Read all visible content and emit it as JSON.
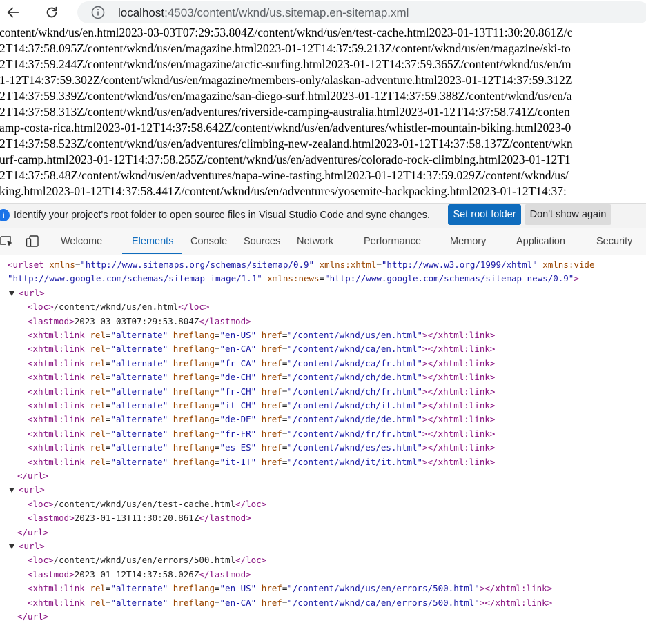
{
  "address_bar": {
    "url_host": "localhost",
    "url_rest": ":4503/content/wknd/us.sitemap.en-sitemap.xml"
  },
  "page_lines": [
    "content/wknd/us/en.html2023-03-03T07:29:53.804Z/content/wknd/us/en/test-cache.html2023-01-13T11:30:20.861Z/c",
    "2T14:37:58.095Z/content/wknd/us/en/magazine.html2023-01-12T14:37:59.213Z/content/wknd/us/en/magazine/ski-to",
    "2T14:37:59.244Z/content/wknd/us/en/magazine/arctic-surfing.html2023-01-12T14:37:59.365Z/content/wknd/us/en/m",
    "1-12T14:37:59.302Z/content/wknd/us/en/magazine/members-only/alaskan-adventure.html2023-01-12T14:37:59.312Z",
    "2T14:37:59.339Z/content/wknd/us/en/magazine/san-diego-surf.html2023-01-12T14:37:59.388Z/content/wknd/us/en/a",
    "2T14:37:58.313Z/content/wknd/us/en/adventures/riverside-camping-australia.html2023-01-12T14:37:58.741Z/conten",
    "amp-costa-rica.html2023-01-12T14:37:58.642Z/content/wknd/us/en/adventures/whistler-mountain-biking.html2023-0",
    "2T14:37:58.523Z/content/wknd/us/en/adventures/climbing-new-zealand.html2023-01-12T14:37:58.137Z/content/wkn",
    "urf-camp.html2023-01-12T14:37:58.255Z/content/wknd/us/en/adventures/colorado-rock-climbing.html2023-01-12T1",
    "2T14:37:58.48Z/content/wknd/us/en/adventures/napa-wine-tasting.html2023-01-12T14:37:59.029Z/content/wknd/us/",
    "king.html2023-01-12T14:37:58.441Z/content/wknd/us/en/adventures/yosemite-backpacking.html2023-01-12T14:37:"
  ],
  "infobar": {
    "message": "Identify your project's root folder to open source files in Visual Studio Code and sync changes.",
    "set_root_label": "Set root folder",
    "dont_show_label": "Don't show again"
  },
  "devtools_tabs": [
    "Welcome",
    "Elements",
    "Console",
    "Sources",
    "Network",
    "Performance",
    "Memory",
    "Application",
    "Security"
  ],
  "active_tab": "Elements",
  "xml": {
    "urlset_line1": {
      "open": "<urlset",
      "a1": "xmlns",
      "v1": "\"http://www.sitemaps.org/schemas/sitemap/0.9\"",
      "a2": "xmlns:xhtml",
      "v2": "\"http://www.w3.org/1999/xhtml\"",
      "a3": "xmlns:vide"
    },
    "urlset_line2": {
      "v0": "\"http://www.google.com/schemas/sitemap-image/1.1\"",
      "a": "xmlns:news",
      "v": "\"http://www.google.com/schemas/sitemap-news/0.9\"",
      "close": ">"
    },
    "tags": {
      "url_open": "<url>",
      "url_close": "</url>",
      "loc_open": "<loc>",
      "loc_close": "</loc>",
      "lastmod_open": "<lastmod>",
      "lastmod_close": "</lastmod>",
      "link_open": "<xhtml:link",
      "link_close": "></xhtml:link>",
      "rel_attr": "rel",
      "rel_value": "\"alternate\"",
      "hreflang_attr": "hreflang",
      "href_attr": "href",
      "equals": "="
    },
    "url_blocks": [
      {
        "loc": "/content/wknd/us/en.html",
        "lastmod": "2023-03-03T07:29:53.804Z",
        "links": [
          {
            "hreflang": "\"en-US\"",
            "href": "\"/content/wknd/us/en.html\""
          },
          {
            "hreflang": "\"en-CA\"",
            "href": "\"/content/wknd/ca/en.html\""
          },
          {
            "hreflang": "\"fr-CA\"",
            "href": "\"/content/wknd/ca/fr.html\""
          },
          {
            "hreflang": "\"de-CH\"",
            "href": "\"/content/wknd/ch/de.html\""
          },
          {
            "hreflang": "\"fr-CH\"",
            "href": "\"/content/wknd/ch/fr.html\""
          },
          {
            "hreflang": "\"it-CH\"",
            "href": "\"/content/wknd/ch/it.html\""
          },
          {
            "hreflang": "\"de-DE\"",
            "href": "\"/content/wknd/de/de.html\""
          },
          {
            "hreflang": "\"fr-FR\"",
            "href": "\"/content/wknd/fr/fr.html\""
          },
          {
            "hreflang": "\"es-ES\"",
            "href": "\"/content/wknd/es/es.html\""
          },
          {
            "hreflang": "\"it-IT\"",
            "href": "\"/content/wknd/it/it.html\""
          }
        ]
      },
      {
        "loc": "/content/wknd/us/en/test-cache.html",
        "lastmod": "2023-01-13T11:30:20.861Z",
        "links": []
      },
      {
        "loc": "/content/wknd/us/en/errors/500.html",
        "lastmod": "2023-01-12T14:37:58.026Z",
        "links": [
          {
            "hreflang": "\"en-US\"",
            "href": "\"/content/wknd/us/en/errors/500.html\""
          },
          {
            "hreflang": "\"en-CA\"",
            "href": "\"/content/wknd/ca/en/errors/500.html\""
          }
        ]
      }
    ]
  },
  "colors": {
    "accent": "#0f6cbd",
    "tag": "#881280",
    "attr_name": "#994500",
    "attr_value": "#1a1aa6"
  }
}
